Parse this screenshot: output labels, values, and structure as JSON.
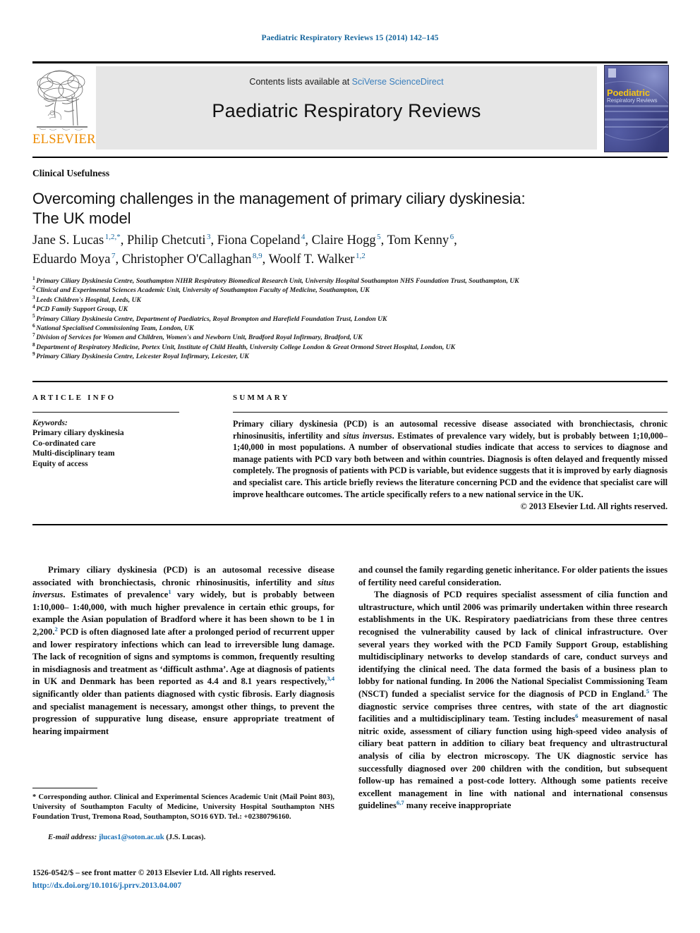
{
  "running_head": "Paediatric Respiratory Reviews 15 (2014) 142–145",
  "masthead": {
    "publisher_name": "ELSEVIER",
    "contents_prefix": "Contents lists available at ",
    "contents_link": "SciVerse ScienceDirect",
    "journal_name": "Paediatric Respiratory Reviews",
    "cover": {
      "title": "Poediatric",
      "subtitle": "Respiratory Reviews"
    }
  },
  "article": {
    "section_label": "Clinical Usefulness",
    "title_line_1": "Overcoming challenges in the management of primary ciliary dyskinesia:",
    "title_line_2": "The UK model",
    "authors": [
      {
        "name": "Jane S. Lucas",
        "sup": "1,2,*"
      },
      {
        "name": "Philip Chetcuti",
        "sup": "3"
      },
      {
        "name": "Fiona Copeland",
        "sup": "4"
      },
      {
        "name": "Claire Hogg",
        "sup": "5"
      },
      {
        "name": "Tom Kenny",
        "sup": "6"
      },
      {
        "name": "Eduardo Moya",
        "sup": "7"
      },
      {
        "name": "Christopher O'Callaghan",
        "sup": "8,9"
      },
      {
        "name": "Woolf T. Walker",
        "sup": "1,2"
      }
    ],
    "affiliations": [
      {
        "num": "1",
        "text": "Primary Ciliary Dyskinesia Centre, Southampton NIHR Respiratory Biomedical Research Unit, University Hospital Southampton NHS Foundation Trust, Southampton, UK"
      },
      {
        "num": "2",
        "text": "Clinical and Experimental Sciences Academic Unit, University of Southampton Faculty of Medicine, Southampton, UK"
      },
      {
        "num": "3",
        "text": "Leeds Children's Hospital, Leeds, UK"
      },
      {
        "num": "4",
        "text": "PCD Family Support Group, UK"
      },
      {
        "num": "5",
        "text": "Primary Ciliary Dyskinesia Centre, Department of Paediatrics, Royal Brompton and Harefield Foundation Trust, London UK"
      },
      {
        "num": "6",
        "text": "National Specialised Commissioning Team, London, UK"
      },
      {
        "num": "7",
        "text": "Division of Services for Women and Children, Women's and Newborn Unit, Bradford Royal Infirmary, Bradford, UK"
      },
      {
        "num": "8",
        "text": "Department of Respiratory Medicine, Portex Unit, Institute of Child Health, University College London & Great Ormond Street Hospital, London, UK"
      },
      {
        "num": "9",
        "text": "Primary Ciliary Dyskinesia Centre, Leicester Royal Infirmary, Leicester, UK"
      }
    ]
  },
  "article_info": {
    "heading": "ARTICLE INFO",
    "keywords_label": "Keywords:",
    "keywords": [
      "Primary ciliary dyskinesia",
      "Co-ordinated care",
      "Multi-disciplinary team",
      "Equity of access"
    ]
  },
  "summary": {
    "heading": "SUMMARY",
    "body_part_1": "Primary ciliary dyskinesia (PCD) is an autosomal recessive disease associated with bronchiectasis, chronic rhinosinusitis, infertility and ",
    "body_italic": "situs inversus",
    "body_part_2": ". Estimates of prevalence vary widely, but is probably between 1;10,000– 1;40,000 in most populations. A number of observational studies indicate that access to services to diagnose and manage patients with PCD vary both between and within countries. Diagnosis is often delayed and frequently missed completely. The prognosis of patients with PCD is variable, but evidence suggests that it is improved by early diagnosis and specialist care. This article briefly reviews the literature concerning PCD and the evidence that specialist care will improve healthcare outcomes. The article specifically refers to a new national service in the UK.",
    "copyright": "© 2013 Elsevier Ltd. All rights reserved."
  },
  "body": {
    "left_col": {
      "p1_a": "Primary ciliary dyskinesia (PCD) is an autosomal recessive disease associated with bronchiectasis, chronic rhinosinusitis, infertility and ",
      "p1_italic": "situs inversus",
      "p1_b": ". Estimates of prevalence",
      "p1_ref1": "1",
      "p1_c": " vary widely, but is probably between 1:10,000– 1:40,000, with much higher prevalence in certain ethic groups, for example the Asian population of Bradford where it has been shown to be 1 in 2,200.",
      "p1_ref2": "2",
      "p1_d": " PCD is often diagnosed late after a prolonged period of recurrent upper and lower respiratory infections which can lead to irreversible lung damage. The lack of recognition of signs and symptoms is common, frequently resulting in misdiagnosis and treatment as ‘difficult asthma’. Age at diagnosis of patients in UK and Denmark has been reported as 4.4 and 8.1 years respectively,",
      "p1_ref3": "3,4",
      "p1_e": " significantly older than patients diagnosed with cystic fibrosis. Early diagnosis and specialist management is necessary, amongst other things, to prevent the progression of suppurative lung disease, ensure appropriate treatment of hearing impairment"
    },
    "right_col": {
      "p1": "and counsel the family regarding genetic inheritance. For older patients the issues of fertility need careful consideration.",
      "p2_a": "The diagnosis of PCD requires specialist assessment of cilia function and ultrastructure, which until 2006 was primarily undertaken within three research establishments in the UK. Respiratory paediatricians from these three centres recognised the vulnerability caused by lack of clinical infrastructure. Over several years they worked with the PCD Family Support Group, establishing multidisciplinary networks to develop standards of care, conduct surveys and identifying the clinical need. The data formed the basis of a business plan to lobby for national funding. In 2006 the National Specialist Commissioning Team (NSCT) funded a specialist service for the diagnosis of PCD in England.",
      "p2_ref5": "5",
      "p2_b": " The diagnostic service comprises three centres, with state of the art diagnostic facilities and a multidisciplinary team. Testing includes",
      "p2_ref6": "6",
      "p2_c": " measurement of nasal nitric oxide, assessment of ciliary function using high-speed video analysis of ciliary beat pattern in addition to ciliary beat frequency and ultrastructural analysis of cilia by electron microscopy. The UK diagnostic service has successfully diagnosed over 200 children with the condition, but subsequent follow-up has remained a post-code lottery. Although some patients receive excellent management in line with national and international consensus guidelines",
      "p2_ref67": "6,7",
      "p2_d": " many receive inappropriate"
    }
  },
  "footer": {
    "corresponding_star": "*",
    "corresponding_text": "Corresponding author. Clinical and Experimental Sciences Academic Unit (Mail Point 803), University of Southampton Faculty of Medicine, University Hospital Southampton NHS Foundation Trust, Tremona Road, Southampton, SO16 6YD. Tel.: +02380796160.",
    "email_label": "E-mail address:",
    "email": "jlucas1@soton.ac.uk",
    "email_attrib": "(J.S. Lucas).",
    "issn_line": "1526-0542/$ – see front matter © 2013 Elsevier Ltd. All rights reserved.",
    "doi": "http://dx.doi.org/10.1016/j.prrv.2013.04.007"
  },
  "colors": {
    "link_blue": "#1a6fb5",
    "runhead_blue": "#15659c",
    "elsevier_orange": "#ed8b00",
    "band_grey": "#e6e6e6",
    "cover_yellow": "#f5c518"
  }
}
